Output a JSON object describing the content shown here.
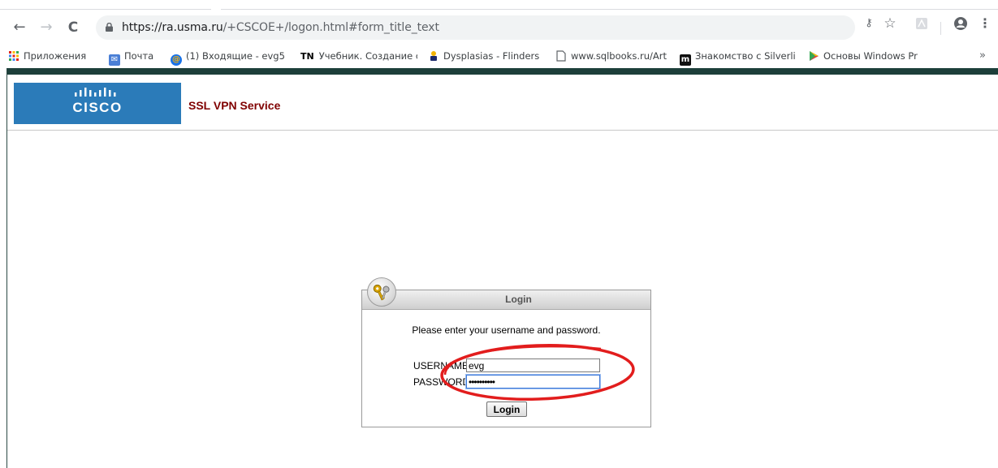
{
  "browser": {
    "nav": {
      "back_icon": "←",
      "forward_icon": "→",
      "reload_icon": "C"
    },
    "address_bar": {
      "url_host": "https://ra.usma.ru",
      "url_path": "/+CSCOE+/logon.html#form_title_text"
    },
    "toolbar_icons": {
      "key": "⚷",
      "star": "☆",
      "profile": "●",
      "menu": "⋮"
    },
    "bookmarks": [
      {
        "label": "Приложения",
        "icon": "apps-icon"
      },
      {
        "label": "Почта",
        "icon": "mail-icon"
      },
      {
        "label": "(1) Входящие - evg5",
        "icon": "mailru-icon"
      },
      {
        "label": "Учебник. Создание с",
        "icon": "tn-icon",
        "icon_text": "TN"
      },
      {
        "label": "Dysplasias - Flinders",
        "icon": "flinders-icon"
      },
      {
        "label": "www.sqlbooks.ru/Arti",
        "icon": "page-icon"
      },
      {
        "label": "Знакомство с Silverli",
        "icon": "m-icon",
        "icon_text": "m"
      },
      {
        "label": "Основы Windows Pr",
        "icon": "play-icon"
      }
    ],
    "bookmarks_overflow": "»"
  },
  "header": {
    "logo_text": "CISCO",
    "title": "SSL VPN Service"
  },
  "login": {
    "panel_title": "Login",
    "message": "Please enter your username and password.",
    "username_label": "USERNAME:",
    "username_value": "evg",
    "password_label": "PASSWORD:",
    "password_value": "••••••••••",
    "button_label": "Login"
  },
  "colors": {
    "cisco_blue": "#2b7bb9",
    "header_title": "#800000",
    "top_band": "#1d3f3a",
    "annotation": "#e21d1d"
  }
}
